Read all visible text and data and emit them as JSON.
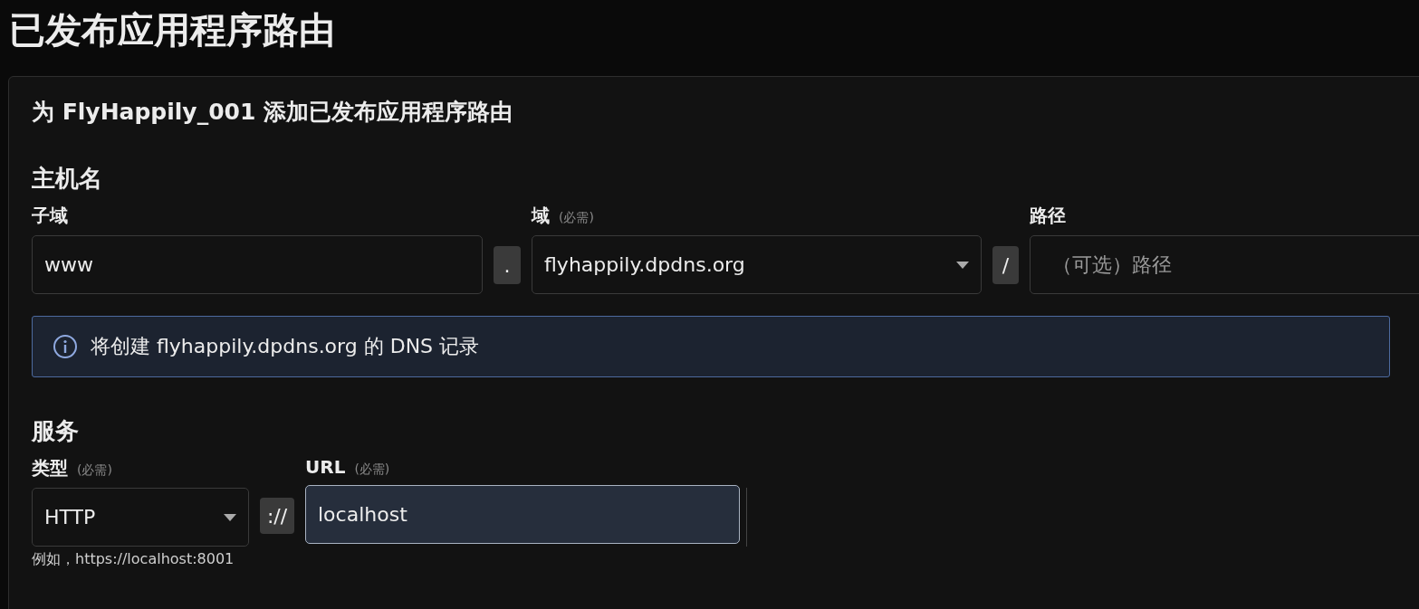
{
  "page_title": "已发布应用程序路由",
  "card": {
    "title": "为 FlyHappily_001 添加已发布应用程序路由",
    "hostname": {
      "heading": "主机名",
      "subdomain": {
        "label": "子域",
        "value": "www"
      },
      "separator_dot": ".",
      "domain": {
        "label": "域",
        "required": "(必需)",
        "value": "flyhappily.dpdns.org"
      },
      "separator_slash": "/",
      "path": {
        "label": "路径",
        "placeholder": "（可选）路径"
      }
    },
    "alert": {
      "text": "将创建 flyhappily.dpdns.org 的 DNS 记录"
    },
    "service": {
      "heading": "服务",
      "type": {
        "label": "类型",
        "required": "(必需)",
        "value": "HTTP",
        "hint": "例如，https://localhost:8001"
      },
      "separator_scheme": "://",
      "url": {
        "label": "URL",
        "required": "(必需)",
        "value": "localhost",
        "focused": true
      }
    }
  }
}
